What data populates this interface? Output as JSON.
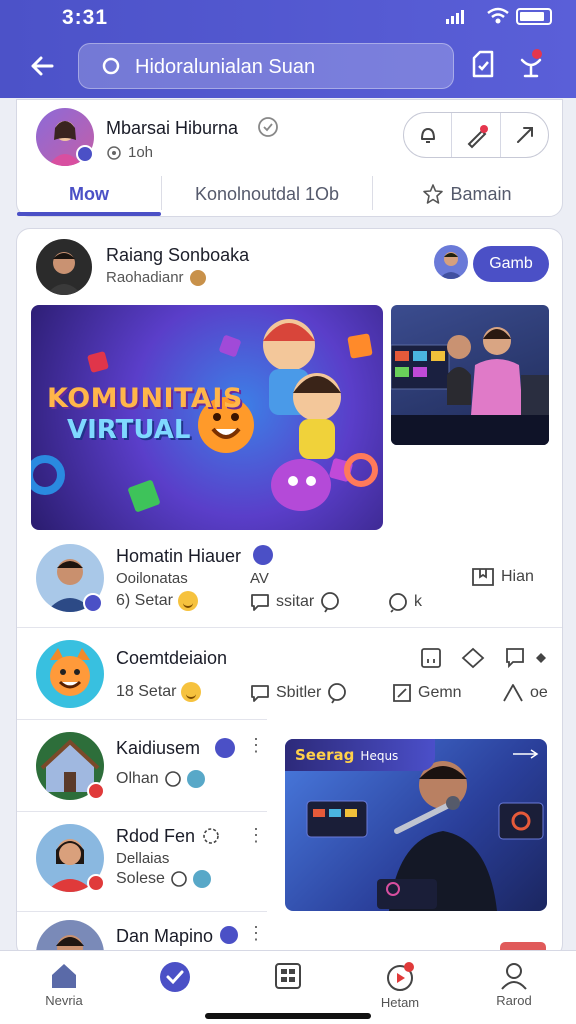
{
  "status": {
    "time": "3:31"
  },
  "search": {
    "placeholder": "Hidoralunialan Suan"
  },
  "profile": {
    "name": "Mbarsai Hiburna",
    "meta": "1oh",
    "tabs": [
      {
        "label": "Mow"
      },
      {
        "label": "Konolnoutdal 1Ob"
      },
      {
        "label": "Bamain"
      }
    ]
  },
  "feed": {
    "poster": {
      "name": "Raiang Sonboaka",
      "sub": "Raohadianr",
      "button": "Gamb"
    },
    "banner": {
      "line1": "KOMUNITAIS",
      "line2": "VIRTUAL"
    },
    "post1": {
      "name": "Homatin Hiauer",
      "sub": "Ooilonatas",
      "tag": "AV",
      "stats": {
        "likes": "6) Setar",
        "comments": "ssitar",
        "shares": "k",
        "save": "Hian"
      }
    },
    "post2": {
      "name": "Coemtdeiaion",
      "stats": {
        "likes": "18 Setar",
        "comments": "Sbitler",
        "edit": "Gemn",
        "share": "oe"
      }
    },
    "list": [
      {
        "name": "Kaidiusem",
        "sub": "Olhan"
      },
      {
        "name": "Rdod Fen",
        "sub": "Dellaias",
        "sub2": "Solese"
      },
      {
        "name": "Dan Mapino"
      }
    ],
    "live": {
      "title": "Seerag",
      "subtitle": "Hequs"
    }
  },
  "bottom_nav": [
    {
      "label": "Nevria",
      "icon": "home-icon"
    },
    {
      "label": "",
      "icon": "check-badge-icon"
    },
    {
      "label": "",
      "icon": "grid-icon"
    },
    {
      "label": "Hetam",
      "icon": "play-icon"
    },
    {
      "label": "Rarod",
      "icon": "person-icon"
    }
  ],
  "colors": {
    "primary": "#4b50c6",
    "background": "#eceef5"
  }
}
